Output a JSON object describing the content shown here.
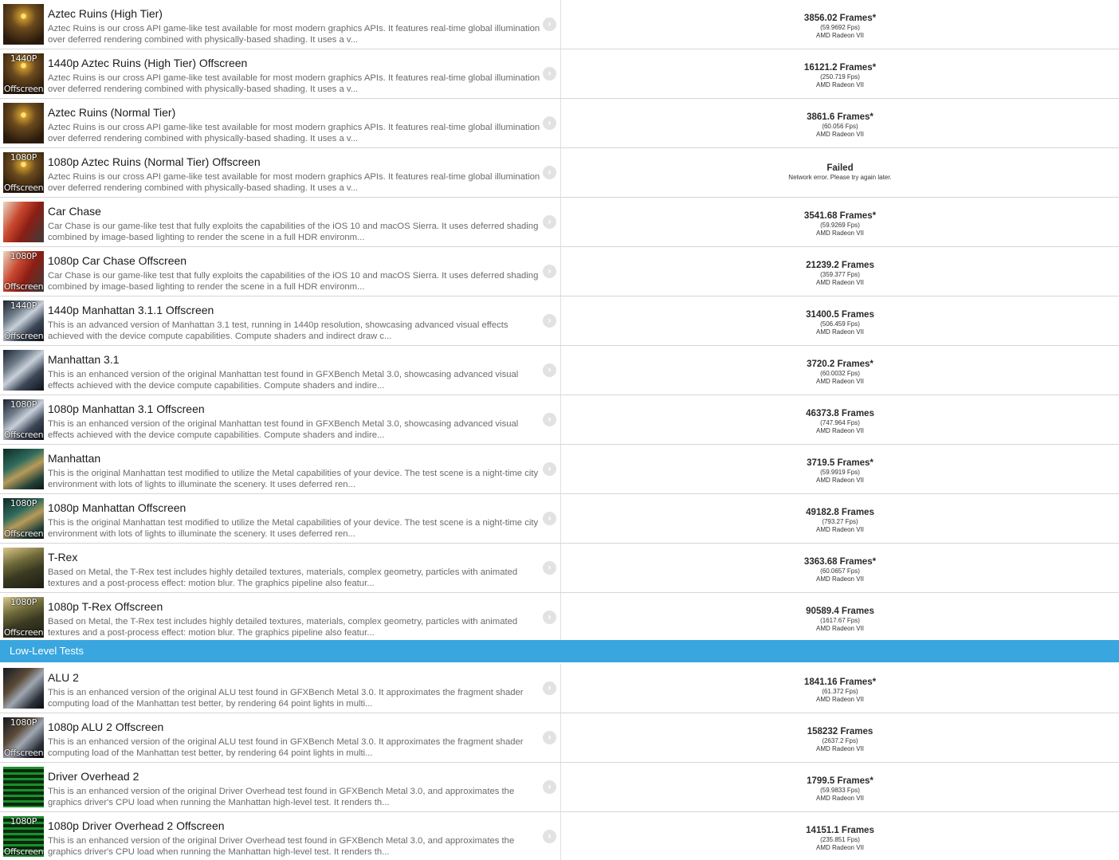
{
  "section_header": "Low-Level Tests",
  "tests": [
    {
      "thumb": "aztec",
      "cap_top": "",
      "cap_bottom": "",
      "title": "Aztec Ruins (High Tier)",
      "desc": "Aztec Ruins is our cross API game-like test available for most modern graphics APIs. It features real-time global illumination over deferred rendering combined with physically-based shading. It uses a v...",
      "score": "3856.02 Frames*",
      "fps": "(59.9692 Fps)",
      "device": "AMD Radeon VII"
    },
    {
      "thumb": "aztec",
      "cap_top": "1440P",
      "cap_bottom": "Offscreen",
      "title": "1440p Aztec Ruins (High Tier) Offscreen",
      "desc": "Aztec Ruins is our cross API game-like test available for most modern graphics APIs. It features real-time global illumination over deferred rendering combined with physically-based shading. It uses a v...",
      "score": "16121.2 Frames*",
      "fps": "(250.719 Fps)",
      "device": "AMD Radeon VII"
    },
    {
      "thumb": "aztec",
      "cap_top": "",
      "cap_bottom": "",
      "title": "Aztec Ruins (Normal Tier)",
      "desc": "Aztec Ruins is our cross API game-like test available for most modern graphics APIs. It features real-time global illumination over deferred rendering combined with physically-based shading. It uses a v...",
      "score": "3861.6 Frames*",
      "fps": "(60.056 Fps)",
      "device": "AMD Radeon VII"
    },
    {
      "thumb": "aztec",
      "cap_top": "1080P",
      "cap_bottom": "Offscreen",
      "title": "1080p Aztec Ruins (Normal Tier) Offscreen",
      "desc": "Aztec Ruins is our cross API game-like test available for most modern graphics APIs. It features real-time global illumination over deferred rendering combined with physically-based shading. It uses a v...",
      "score": "Failed",
      "fps": "Network error. Please try again later.",
      "device": ""
    },
    {
      "thumb": "car",
      "cap_top": "",
      "cap_bottom": "",
      "title": "Car Chase",
      "desc": "Car Chase is our game-like test that fully exploits the capabilities of the iOS 10 and macOS Sierra. It uses deferred shading combined by image-based lighting to render the scene in a full HDR environm...",
      "score": "3541.68 Frames*",
      "fps": "(59.9269 Fps)",
      "device": "AMD Radeon VII"
    },
    {
      "thumb": "car",
      "cap_top": "1080P",
      "cap_bottom": "Offscreen",
      "title": "1080p Car Chase Offscreen",
      "desc": "Car Chase is our game-like test that fully exploits the capabilities of the iOS 10 and macOS Sierra. It uses deferred shading combined by image-based lighting to render the scene in a full HDR environm...",
      "score": "21239.2 Frames",
      "fps": "(359.377 Fps)",
      "device": "AMD Radeon VII"
    },
    {
      "thumb": "manh",
      "cap_top": "1440P",
      "cap_bottom": "Offscreen",
      "title": "1440p Manhattan 3.1.1 Offscreen",
      "desc": "This is an advanced version of Manhattan 3.1 test, running in 1440p resolution, showcasing advanced visual effects achieved with the device compute capabilities. Compute shaders and indirect draw c...",
      "score": "31400.5 Frames",
      "fps": "(506.459 Fps)",
      "device": "AMD Radeon VII"
    },
    {
      "thumb": "manh",
      "cap_top": "",
      "cap_bottom": "",
      "title": "Manhattan 3.1",
      "desc": "This is an enhanced version of the original Manhattan test found in GFXBench Metal 3.0, showcasing advanced visual effects achieved with the device compute capabilities. Compute shaders and indire...",
      "score": "3720.2 Frames*",
      "fps": "(60.0032 Fps)",
      "device": "AMD Radeon VII"
    },
    {
      "thumb": "manh",
      "cap_top": "1080P",
      "cap_bottom": "Offscreen",
      "title": "1080p Manhattan 3.1 Offscreen",
      "desc": "This is an enhanced version of the original Manhattan test found in GFXBench Metal 3.0, showcasing advanced visual effects achieved with the device compute capabilities. Compute shaders and indire...",
      "score": "46373.8 Frames",
      "fps": "(747.964 Fps)",
      "device": "AMD Radeon VII"
    },
    {
      "thumb": "manhold",
      "cap_top": "",
      "cap_bottom": "",
      "title": "Manhattan",
      "desc": "This is the original Manhattan test modified to utilize the Metal capabilities of your device. The test scene is a night-time city environment with lots of lights to illuminate the scenery. It uses deferred ren...",
      "score": "3719.5 Frames*",
      "fps": "(59.9919 Fps)",
      "device": "AMD Radeon VII"
    },
    {
      "thumb": "manhold",
      "cap_top": "1080P",
      "cap_bottom": "Offscreen",
      "title": "1080p Manhattan Offscreen",
      "desc": "This is the original Manhattan test modified to utilize the Metal capabilities of your device. The test scene is a night-time city environment with lots of lights to illuminate the scenery. It uses deferred ren...",
      "score": "49182.8 Frames",
      "fps": "(793.27 Fps)",
      "device": "AMD Radeon VII"
    },
    {
      "thumb": "trex",
      "cap_top": "",
      "cap_bottom": "",
      "title": "T-Rex",
      "desc": "Based on Metal, the T-Rex test includes highly detailed textures, materials, complex geometry, particles with animated textures and a post-process effect: motion blur. The graphics pipeline also featur...",
      "score": "3363.68 Frames*",
      "fps": "(60.0657 Fps)",
      "device": "AMD Radeon VII"
    },
    {
      "thumb": "trex",
      "cap_top": "1080P",
      "cap_bottom": "Offscreen",
      "title": "1080p T-Rex Offscreen",
      "desc": "Based on Metal, the T-Rex test includes highly detailed textures, materials, complex geometry, particles with animated textures and a post-process effect: motion blur. The graphics pipeline also featur...",
      "score": "90589.4 Frames",
      "fps": "(1617.67 Fps)",
      "device": "AMD Radeon VII"
    }
  ],
  "low_level_tests": [
    {
      "thumb": "alu",
      "cap_top": "",
      "cap_bottom": "",
      "title": "ALU 2",
      "desc": "This is an enhanced version of the original ALU test found in GFXBench Metal 3.0. It approximates the fragment shader computing load of the Manhattan test better, by rendering 64 point lights in multi...",
      "score": "1841.16 Frames*",
      "fps": "(61.372 Fps)",
      "device": "AMD Radeon VII"
    },
    {
      "thumb": "alu",
      "cap_top": "1080P",
      "cap_bottom": "Offscreen",
      "title": "1080p ALU 2 Offscreen",
      "desc": "This is an enhanced version of the original ALU test found in GFXBench Metal 3.0. It approximates the fragment shader computing load of the Manhattan test better, by rendering 64 point lights in multi...",
      "score": "158232 Frames",
      "fps": "(2637.2 Fps)",
      "device": "AMD Radeon VII"
    },
    {
      "thumb": "driver",
      "cap_top": "",
      "cap_bottom": "",
      "title": "Driver Overhead 2",
      "desc": "This is an enhanced version of the original Driver Overhead test found in GFXBench Metal 3.0, and approximates the graphics driver's CPU load when running the Manhattan high-level test. It renders th...",
      "score": "1799.5 Frames*",
      "fps": "(59.9833 Fps)",
      "device": "AMD Radeon VII"
    },
    {
      "thumb": "driver",
      "cap_top": "1080P",
      "cap_bottom": "Offscreen",
      "title": "1080p Driver Overhead 2 Offscreen",
      "desc": "This is an enhanced version of the original Driver Overhead test found in GFXBench Metal 3.0, and approximates the graphics driver's CPU load when running the Manhattan high-level test. It renders th...",
      "score": "14151.1 Frames",
      "fps": "(235.851 Fps)",
      "device": "AMD Radeon VII"
    }
  ],
  "chevron_glyph": "›",
  "accent_color": "#39a6df"
}
